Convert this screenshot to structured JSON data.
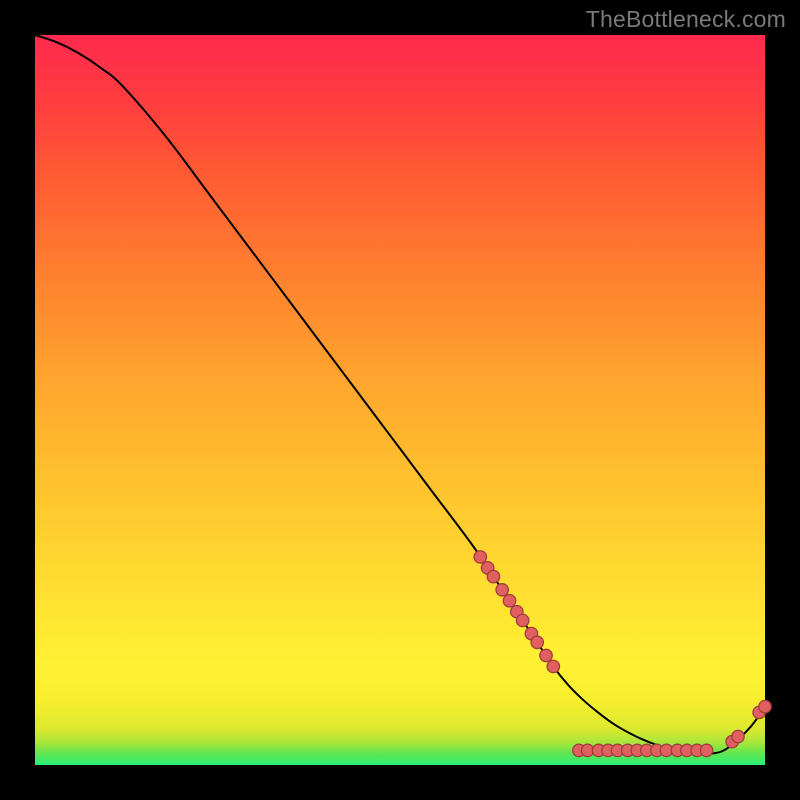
{
  "watermark": "TheBottleneck.com",
  "colors": {
    "background": "#000000",
    "watermark": "#7a7a7a",
    "curve": "#000000",
    "dot_fill": "#e06060",
    "dot_stroke": "#a23d3d"
  },
  "chart_data": {
    "type": "line",
    "title": "",
    "xlabel": "",
    "ylabel": "",
    "xlim": [
      0,
      100
    ],
    "ylim": [
      0,
      100
    ],
    "grid": false,
    "legend": false,
    "series": [
      {
        "name": "curve",
        "x": [
          0,
          3,
          6,
          9,
          12,
          18,
          24,
          30,
          36,
          42,
          48,
          54,
          60,
          64,
          68,
          71,
          73,
          75,
          77,
          79,
          81,
          83,
          85,
          87,
          89,
          91,
          93,
          95,
          98,
          100
        ],
        "y": [
          100,
          99,
          97.5,
          95.5,
          93,
          86,
          78,
          70,
          62,
          54,
          46,
          38,
          30,
          24,
          18,
          13.5,
          11,
          9,
          7.3,
          5.8,
          4.6,
          3.6,
          2.8,
          2.2,
          1.8,
          1.6,
          1.6,
          2.4,
          5.2,
          8.0
        ]
      }
    ],
    "dots": [
      {
        "x": 61,
        "y": 28.5
      },
      {
        "x": 62,
        "y": 27.0
      },
      {
        "x": 62.8,
        "y": 25.8
      },
      {
        "x": 64,
        "y": 24.0
      },
      {
        "x": 65,
        "y": 22.5
      },
      {
        "x": 66,
        "y": 21.0
      },
      {
        "x": 66.8,
        "y": 19.8
      },
      {
        "x": 68,
        "y": 18.0
      },
      {
        "x": 68.8,
        "y": 16.8
      },
      {
        "x": 70,
        "y": 15.0
      },
      {
        "x": 71,
        "y": 13.5
      },
      {
        "x": 74.5,
        "y": 2.0
      },
      {
        "x": 75.7,
        "y": 2.0
      },
      {
        "x": 77.2,
        "y": 2.0
      },
      {
        "x": 78.5,
        "y": 2.0
      },
      {
        "x": 79.8,
        "y": 2.0
      },
      {
        "x": 81.2,
        "y": 2.0
      },
      {
        "x": 82.5,
        "y": 2.0
      },
      {
        "x": 83.8,
        "y": 2.0
      },
      {
        "x": 85.2,
        "y": 2.0
      },
      {
        "x": 86.5,
        "y": 2.0
      },
      {
        "x": 88.0,
        "y": 2.0
      },
      {
        "x": 89.3,
        "y": 2.0
      },
      {
        "x": 90.7,
        "y": 2.0
      },
      {
        "x": 92.0,
        "y": 2.0
      },
      {
        "x": 95.5,
        "y": 3.2
      },
      {
        "x": 96.3,
        "y": 3.9
      },
      {
        "x": 99.2,
        "y": 7.2
      },
      {
        "x": 100.0,
        "y": 8.0
      }
    ]
  }
}
